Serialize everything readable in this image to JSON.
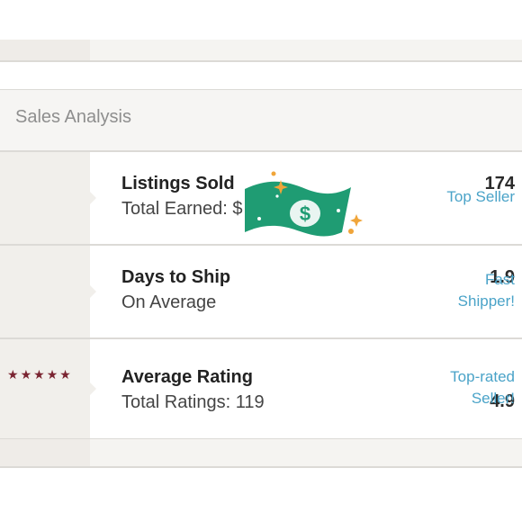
{
  "header": {
    "title": "Sales Analysis"
  },
  "rows": [
    {
      "number": "174",
      "title": "Listings Sold",
      "subtitle": "Total Earned: $",
      "tag_lines": [
        "Top Seller"
      ]
    },
    {
      "number": "1.9",
      "title": "Days to Ship",
      "subtitle": "On Average",
      "tag_lines": [
        "Fast",
        "Shipper!"
      ]
    },
    {
      "number": "4.9",
      "title": "Average Rating",
      "subtitle": "Total Ratings: 119",
      "tag_lines": [
        "Top-rated",
        "Seller!"
      ],
      "stars": 5
    }
  ],
  "colors": {
    "accent_link": "#4aa3c8",
    "star": "#7a2431",
    "money_green": "#1f9c73",
    "sparkle": "#f0a53a"
  },
  "icons": {
    "money": "dollar-bill-icon",
    "star": "star-icon"
  }
}
